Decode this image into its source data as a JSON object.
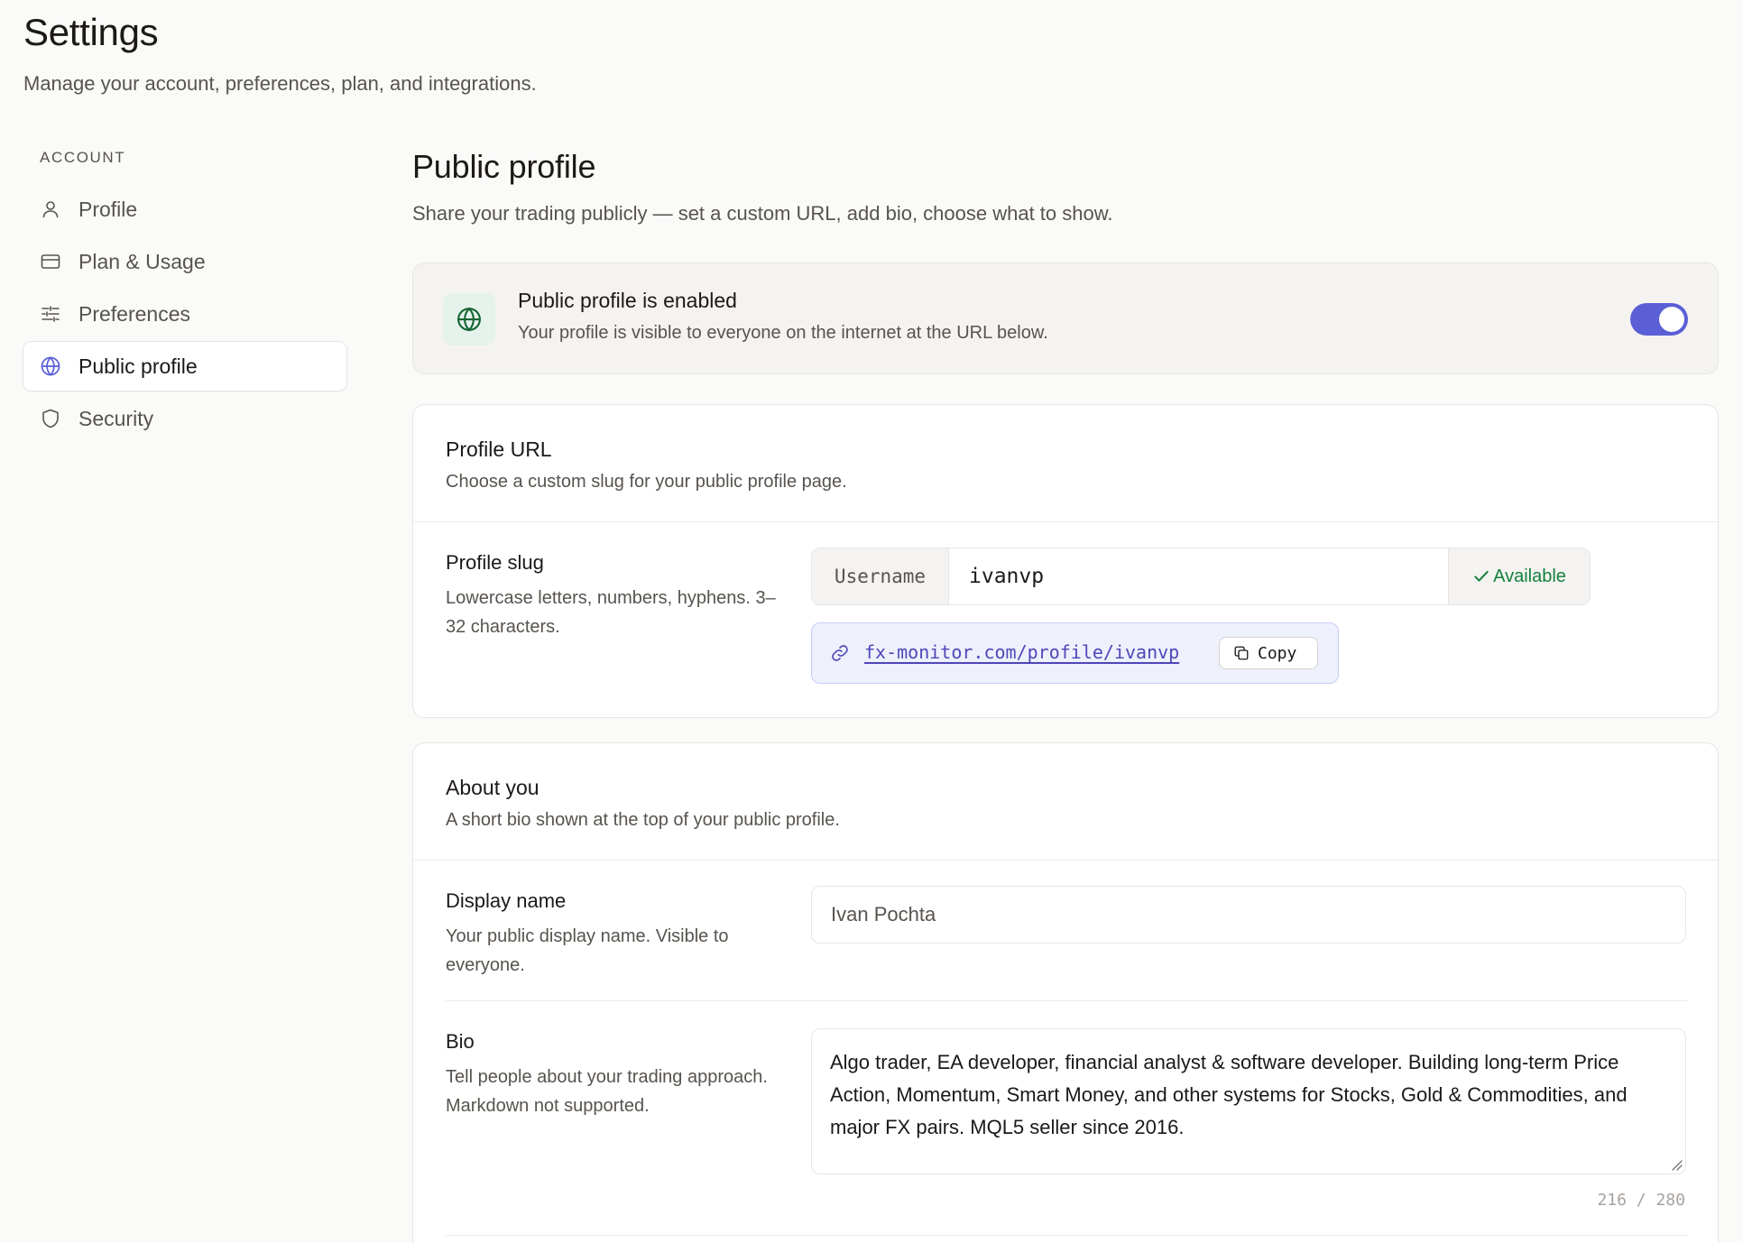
{
  "header": {
    "title": "Settings",
    "subtitle": "Manage your account, preferences, plan, and integrations."
  },
  "sidebar": {
    "section_label": "ACCOUNT",
    "items": [
      {
        "label": "Profile",
        "icon": "user-icon",
        "active": false
      },
      {
        "label": "Plan & Usage",
        "icon": "credit-card-icon",
        "active": false
      },
      {
        "label": "Preferences",
        "icon": "sliders-icon",
        "active": false
      },
      {
        "label": "Public profile",
        "icon": "globe-icon",
        "active": true
      },
      {
        "label": "Security",
        "icon": "shield-icon",
        "active": false
      }
    ]
  },
  "main": {
    "title": "Public profile",
    "subtitle": "Share your trading publicly — set a custom URL, add bio, choose what to show.",
    "banner": {
      "title": "Public profile is enabled",
      "description": "Your profile is visible to everyone on the internet at the URL below.",
      "icon": "globe-icon",
      "toggle_on": true
    },
    "profile_url_card": {
      "title": "Profile URL",
      "description": "Choose a custom slug for your public profile page.",
      "slug": {
        "label": "Profile slug",
        "help": "Lowercase letters, numbers, hyphens. 3–32 characters.",
        "prefix": "Username",
        "value": "ivanvp",
        "status": "Available"
      },
      "url": "fx-monitor.com/profile/ivanvp",
      "copy_label": "Copy"
    },
    "about_card": {
      "title": "About you",
      "description": "A short bio shown at the top of your public profile.",
      "display_name": {
        "label": "Display name",
        "help": "Your public display name. Visible to everyone.",
        "value": "Ivan Pochta"
      },
      "bio": {
        "label": "Bio",
        "help": "Tell people about your trading approach. Markdown not supported.",
        "value": "Algo trader, EA developer, financial analyst & software developer. Building long-term Price Action, Momentum, Smart Money, and other systems for Stocks, Gold & Commodities, and major FX pairs. MQL5 seller since 2016.",
        "count": "216 / 280"
      }
    }
  },
  "colors": {
    "accent": "#5b5fd6",
    "success": "#15803d",
    "background": "#fafaf9"
  }
}
